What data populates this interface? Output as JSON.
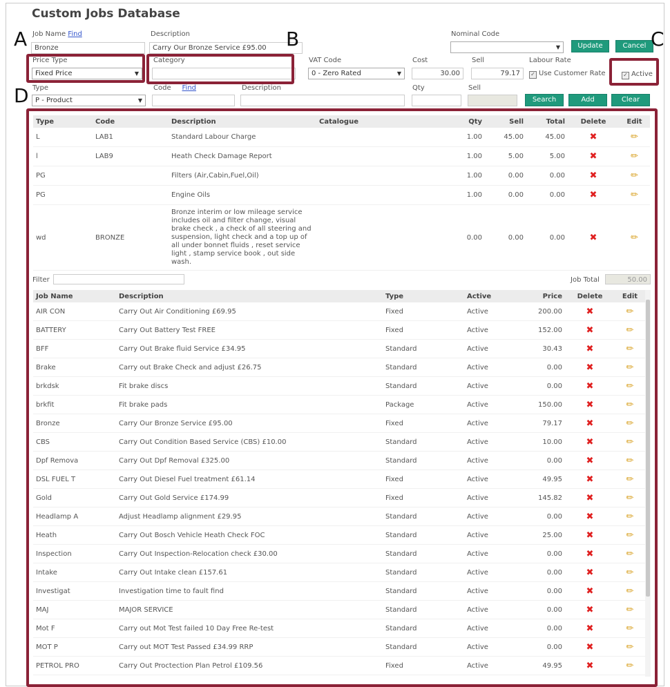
{
  "title": "Custom Jobs Database",
  "form": {
    "job_name_label": "Job Name",
    "find_link": "Find",
    "job_name_value": "Bronze",
    "description_label": "Description",
    "description_value": "Carry Our Bronze Service £95.00",
    "nominal_label": "Nominal Code",
    "update": "Update",
    "cancel": "Cancel",
    "price_type_label": "Price Type",
    "price_type_value": "Fixed Price",
    "category_label": "Category",
    "vat_label": "VAT Code",
    "vat_value": "0 - Zero Rated",
    "cost_label": "Cost",
    "cost_value": "30.00",
    "sell_label": "Sell",
    "sell_value": "79.17",
    "labour_rate_label": "Labour Rate",
    "use_customer_rate": "Use Customer Rate",
    "active_label": "Active",
    "type_label": "Type",
    "type_value": "P - Product",
    "code_label": "Code",
    "code_find": "Find",
    "desc2_label": "Description",
    "qty_label": "Qty",
    "sell2_label": "Sell",
    "search": "Search",
    "add": "Add",
    "clear": "Clear"
  },
  "letters": {
    "a": "A",
    "b": "B",
    "c": "C",
    "d": "D"
  },
  "items_table": {
    "headers": [
      "Type",
      "Code",
      "Description",
      "Catalogue",
      "Qty",
      "Sell",
      "Total",
      "Delete",
      "Edit"
    ],
    "rows": [
      {
        "type": "L",
        "code": "LAB1",
        "desc": "Standard Labour Charge",
        "qty": "1.00",
        "sell": "45.00",
        "total": "45.00"
      },
      {
        "type": "l",
        "code": "LAB9",
        "desc": "Heath Check Damage Report",
        "qty": "1.00",
        "sell": "5.00",
        "total": "5.00"
      },
      {
        "type": "PG",
        "code": "",
        "desc": "Filters (Air,Cabin,Fuel,Oil)",
        "qty": "1.00",
        "sell": "0.00",
        "total": "0.00"
      },
      {
        "type": "PG",
        "code": "",
        "desc": "Engine Oils",
        "qty": "1.00",
        "sell": "0.00",
        "total": "0.00"
      },
      {
        "type": "wd",
        "code": "BRONZE",
        "desc": "Bronze interim or low mileage service includes oil and filter change, visual brake check , a check of all steering and suspension, light check and a top up of all under bonnet fluids , reset service light , stamp service book , out side wash.",
        "qty": "0.00",
        "sell": "0.00",
        "total": "0.00"
      }
    ]
  },
  "filter_label": "Filter",
  "job_total_label": "Job Total",
  "job_total_value": "50.00",
  "jobs_table": {
    "headers": [
      "Job Name",
      "Description",
      "Type",
      "Active",
      "Price",
      "Delete",
      "Edit"
    ],
    "rows": [
      {
        "name": "AIR CON",
        "desc": "Carry Out Air Conditioning £69.95",
        "type": "Fixed",
        "active": "Active",
        "price": "200.00"
      },
      {
        "name": "BATTERY",
        "desc": "Carry Out Battery Test FREE",
        "type": "Fixed",
        "active": "Active",
        "price": "152.00"
      },
      {
        "name": "BFF",
        "desc": "Carry Out Brake fluid Service £34.95",
        "type": "Standard",
        "active": "Active",
        "price": "30.43"
      },
      {
        "name": "Brake",
        "desc": "Carry out Brake Check and adjust £26.75",
        "type": "Standard",
        "active": "Active",
        "price": "0.00"
      },
      {
        "name": "brkdsk",
        "desc": "Fit brake discs",
        "type": "Standard",
        "active": "Active",
        "price": "0.00"
      },
      {
        "name": "brkfit",
        "desc": "Fit brake pads",
        "type": "Package",
        "active": "Active",
        "price": "150.00"
      },
      {
        "name": "Bronze",
        "desc": "Carry Our Bronze Service £95.00",
        "type": "Fixed",
        "active": "Active",
        "price": "79.17"
      },
      {
        "name": "CBS",
        "desc": "Carry Out Condition Based Service (CBS) £10.00",
        "type": "Standard",
        "active": "Active",
        "price": "10.00"
      },
      {
        "name": "Dpf Remova",
        "desc": "Carry Out Dpf Removal £325.00",
        "type": "Standard",
        "active": "Active",
        "price": "0.00"
      },
      {
        "name": "DSL FUEL T",
        "desc": "Carry Out Diesel Fuel treatment £61.14",
        "type": "Fixed",
        "active": "Active",
        "price": "49.95"
      },
      {
        "name": "Gold",
        "desc": "Carry Out Gold Service £174.99",
        "type": "Fixed",
        "active": "Active",
        "price": "145.82"
      },
      {
        "name": "Headlamp A",
        "desc": "Adjust Headlamp alignment £29.95",
        "type": "Standard",
        "active": "Active",
        "price": "0.00"
      },
      {
        "name": "Heath",
        "desc": "Carry Out Bosch Vehicle Heath Check FOC",
        "type": "Standard",
        "active": "Active",
        "price": "25.00"
      },
      {
        "name": "Inspection",
        "desc": "Carry Out Inspection-Relocation check £30.00",
        "type": "Standard",
        "active": "Active",
        "price": "0.00"
      },
      {
        "name": "Intake",
        "desc": "Carry Out Intake clean £157.61",
        "type": "Standard",
        "active": "Active",
        "price": "0.00"
      },
      {
        "name": "Investigat",
        "desc": "Investigation time to fault find",
        "type": "Standard",
        "active": "Active",
        "price": "0.00"
      },
      {
        "name": "MAJ",
        "desc": "MAJOR SERVICE",
        "type": "Standard",
        "active": "Active",
        "price": "0.00"
      },
      {
        "name": "Mot F",
        "desc": "Carry out Mot Test failed 10 Day Free Re-test",
        "type": "Standard",
        "active": "Active",
        "price": "0.00"
      },
      {
        "name": "MOT P",
        "desc": "Carry out MOT Test Passed £34.99 RRP",
        "type": "Standard",
        "active": "Active",
        "price": "0.00"
      },
      {
        "name": "PETROL PRO",
        "desc": "Carry Out Proctection Plan Petrol £109.56",
        "type": "Fixed",
        "active": "Active",
        "price": "49.95"
      }
    ]
  },
  "icons": {
    "delete": "x-icon",
    "edit": "pencil-icon",
    "dropdown": "chevron-down-icon"
  }
}
